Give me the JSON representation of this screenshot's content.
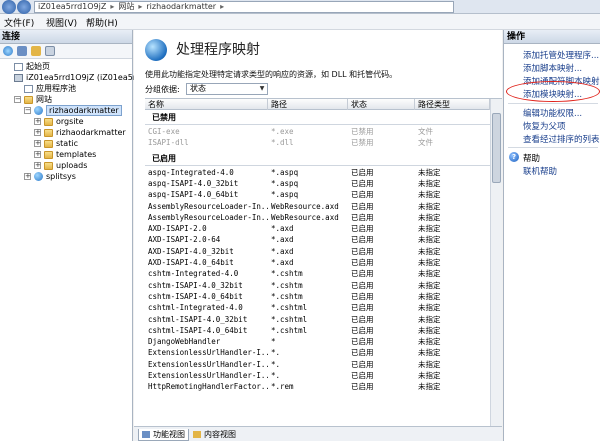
{
  "address": {
    "host": "iZ01ea5rrd1O9jZ",
    "sites": "网站",
    "site": "rizhaodarkmatter"
  },
  "menu": {
    "file": "文件(F)",
    "view": "视图(V)",
    "help": "帮助(H)"
  },
  "connections": {
    "title": "连接",
    "tree": [
      {
        "label": "起始页",
        "level": 0,
        "icon": "page-icon"
      },
      {
        "label": "iZ01ea5rrd1O9jZ (iZ01ea5rr",
        "level": 0,
        "icon": "computer-icon"
      },
      {
        "label": "应用程序池",
        "level": 1,
        "icon": "app-pool-icon"
      },
      {
        "label": "网站",
        "level": 1,
        "icon": "folder-icon"
      },
      {
        "label": "rizhaodarkmatter",
        "level": 2,
        "icon": "globe-icon",
        "selected": true
      },
      {
        "label": "orgsite",
        "level": 3,
        "icon": "folder-icon"
      },
      {
        "label": "rizhaodarkmatter",
        "level": 3,
        "icon": "folder-icon"
      },
      {
        "label": "static",
        "level": 3,
        "icon": "folder-icon"
      },
      {
        "label": "templates",
        "level": 3,
        "icon": "folder-icon"
      },
      {
        "label": "uploads",
        "level": 3,
        "icon": "folder-icon"
      },
      {
        "label": "splitsys",
        "level": 2,
        "icon": "globe-icon"
      }
    ]
  },
  "main": {
    "title": "处理程序映射",
    "description": "使用此功能指定处理特定请求类型的响应的资源，如 DLL 和托管代码。",
    "group_by_label": "分组依据:",
    "group_by_value": "状态",
    "columns": [
      "名称",
      "路径",
      "状态",
      "路径类型"
    ],
    "groups": [
      {
        "name": "已禁用",
        "rows": [
          [
            "CGI-exe",
            "*.exe",
            "已禁用",
            "文件"
          ],
          [
            "ISAPI-dll",
            "*.dll",
            "已禁用",
            "文件"
          ]
        ]
      },
      {
        "name": "已启用",
        "rows": [
          [
            "aspq-Integrated-4.0",
            "*.aspq",
            "已启用",
            "未指定"
          ],
          [
            "aspq-ISAPI-4.0_32bit",
            "*.aspq",
            "已启用",
            "未指定"
          ],
          [
            "aspq-ISAPI-4.0_64bit",
            "*.aspq",
            "已启用",
            "未指定"
          ],
          [
            "AssemblyResourceLoader-In...",
            "WebResource.axd",
            "已启用",
            "未指定"
          ],
          [
            "AssemblyResourceLoader-In...",
            "WebResource.axd",
            "已启用",
            "未指定"
          ],
          [
            "AXD-ISAPI-2.0",
            "*.axd",
            "已启用",
            "未指定"
          ],
          [
            "AXD-ISAPI-2.0-64",
            "*.axd",
            "已启用",
            "未指定"
          ],
          [
            "AXD-ISAPI-4.0_32bit",
            "*.axd",
            "已启用",
            "未指定"
          ],
          [
            "AXD-ISAPI-4.0_64bit",
            "*.axd",
            "已启用",
            "未指定"
          ],
          [
            "cshtm-Integrated-4.0",
            "*.cshtm",
            "已启用",
            "未指定"
          ],
          [
            "cshtm-ISAPI-4.0_32bit",
            "*.cshtm",
            "已启用",
            "未指定"
          ],
          [
            "cshtm-ISAPI-4.0_64bit",
            "*.cshtm",
            "已启用",
            "未指定"
          ],
          [
            "cshtml-Integrated-4.0",
            "*.cshtml",
            "已启用",
            "未指定"
          ],
          [
            "cshtml-ISAPI-4.0_32bit",
            "*.cshtml",
            "已启用",
            "未指定"
          ],
          [
            "cshtml-ISAPI-4.0_64bit",
            "*.cshtml",
            "已启用",
            "未指定"
          ],
          [
            "DjangoWebHandler",
            "*",
            "已启用",
            "未指定"
          ],
          [
            "ExtensionlessUrlHandler-I...",
            "*.",
            "已启用",
            "未指定"
          ],
          [
            "ExtensionlessUrlHandler-I...",
            "*.",
            "已启用",
            "未指定"
          ],
          [
            "ExtensionlessUrlHandler-I...",
            "*.",
            "已启用",
            "未指定"
          ],
          [
            "HttpRemotingHandlerFactor...",
            "*.rem",
            "已启用",
            "未指定"
          ]
        ]
      }
    ],
    "tabs": {
      "features": "功能视图",
      "content": "内容视图"
    }
  },
  "actions": {
    "title": "操作",
    "items": [
      "添加托管处理程序...",
      "添加脚本映射...",
      "添加通配符脚本映射...",
      "添加模块映射...",
      "编辑功能权限...",
      "恢复为父项",
      "查看经过排序的列表..."
    ],
    "help": "帮助",
    "online_help": "联机帮助"
  },
  "colors": {
    "accent": "#1a3f8c",
    "highlight": "#e0221a",
    "disabled_text": "#9a9a9a"
  }
}
